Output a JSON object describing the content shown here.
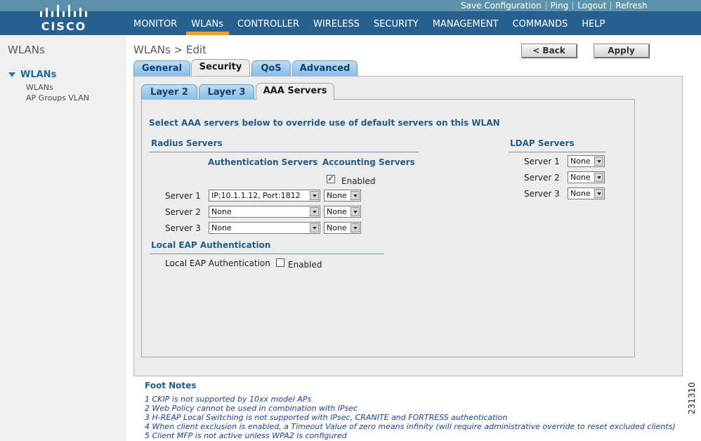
{
  "brand": {
    "wordmark": "CISCO"
  },
  "toplinks": [
    "Save Configuration",
    "Ping",
    "Logout",
    "Refresh"
  ],
  "nav": [
    "MONITOR",
    "WLANs",
    "CONTROLLER",
    "WIRELESS",
    "SECURITY",
    "MANAGEMENT",
    "COMMANDS",
    "HELP"
  ],
  "nav_active": "WLANs",
  "sidebar": {
    "title": "WLANs",
    "section": "WLANs",
    "items": [
      "WLANs",
      "AP Groups VLAN"
    ]
  },
  "page": {
    "title": "WLANs > Edit",
    "back_label": "< Back",
    "apply_label": "Apply"
  },
  "tabs": [
    "General",
    "Security",
    "QoS",
    "Advanced"
  ],
  "active_tab": "Security",
  "subtabs": [
    "Layer 2",
    "Layer 3",
    "AAA Servers"
  ],
  "active_subtab": "AAA Servers",
  "aaa": {
    "intro": "Select AAA servers below to override use of default servers on this WLAN",
    "radius_title": "Radius Servers",
    "auth_header": "Authentication Servers",
    "acct_header": "Accounting Servers",
    "acct_enabled_label": "Enabled",
    "acct_enabled": true,
    "rows": [
      {
        "label": "Server 1",
        "auth": "IP:10.1.1.12, Port:1812",
        "acct": "None"
      },
      {
        "label": "Server 2",
        "auth": "None",
        "acct": "None"
      },
      {
        "label": "Server 3",
        "auth": "None",
        "acct": "None"
      }
    ],
    "local_eap_title": "Local EAP Authentication",
    "local_eap_label": "Local EAP Authentication",
    "local_eap_enabled_label": "Enabled",
    "local_eap_enabled": false,
    "ldap_title": "LDAP Servers",
    "ldap_rows": [
      {
        "label": "Server 1",
        "value": "None"
      },
      {
        "label": "Server 2",
        "value": "None"
      },
      {
        "label": "Server 3",
        "value": "None"
      }
    ]
  },
  "footnotes": {
    "title": "Foot Notes",
    "items": [
      "1 CKIP is not supported by 10xx model APs",
      "2 Web Policy cannot be used in combination with IPsec",
      "3 H-REAP Local Switching is not supported with IPsec, CRANITE and FORTRESS authentication",
      "4 When client exclusion is enabled, a Timeout Value of zero means infinity (will require administrative override to reset excluded clients)",
      "5 Client MFP is not active unless WPA2 is configured"
    ]
  },
  "figure_number": "231310",
  "colors": {
    "header": "#28618f",
    "accent": "#f6a21c",
    "heading": "#235d8a",
    "footnote": "#1a3fa0"
  }
}
